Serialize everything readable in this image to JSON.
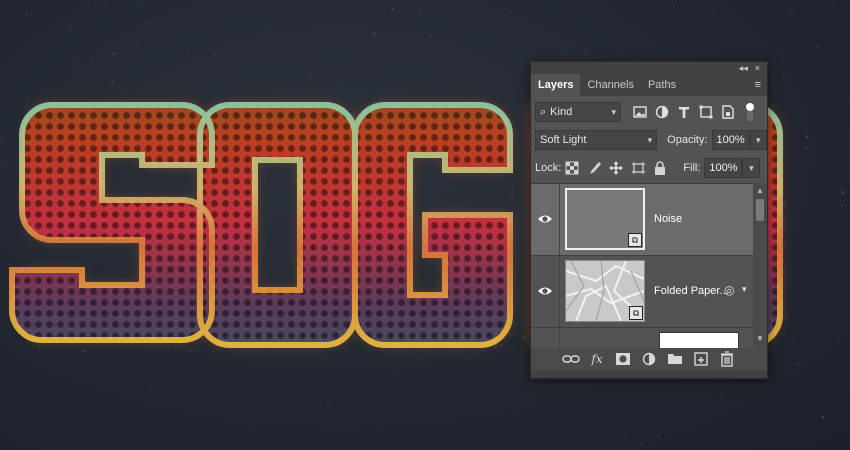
{
  "panel": {
    "title_controls": {
      "collapse": "◂◂",
      "close": "×"
    },
    "tabs": [
      {
        "label": "Layers",
        "active": true
      },
      {
        "label": "Channels",
        "active": false
      },
      {
        "label": "Paths",
        "active": false
      }
    ],
    "tab_menu_icon": "≡",
    "filter": {
      "search_icon": "⌕",
      "kind_label": "Kind",
      "filter_icons": [
        "image-filter-icon",
        "adjustment-filter-icon",
        "type-filter-icon",
        "shape-filter-icon",
        "smart-object-filter-icon",
        "filter-toggle-icon"
      ]
    },
    "blend": {
      "mode": "Soft Light",
      "opacity_label": "Opacity:",
      "opacity_value": "100%"
    },
    "lock": {
      "label": "Lock:",
      "fill_label": "Fill:",
      "fill_value": "100%"
    },
    "layers": [
      {
        "name": "Noise",
        "selected": true,
        "visible": true
      },
      {
        "name": "Folded Paper...",
        "selected": false,
        "visible": true,
        "has_effects": true
      }
    ],
    "bottom_icons": [
      "link-icon",
      "fx-icon",
      "mask-icon",
      "adjustment-icon",
      "group-folder-icon",
      "new-layer-icon",
      "trash-icon"
    ],
    "fx_glyph": "fx"
  },
  "colors": {
    "panel_bg": "#535353",
    "panel_dark": "#424242",
    "selected_row": "#6b6b6b",
    "canvas_bg": "#22272f"
  }
}
